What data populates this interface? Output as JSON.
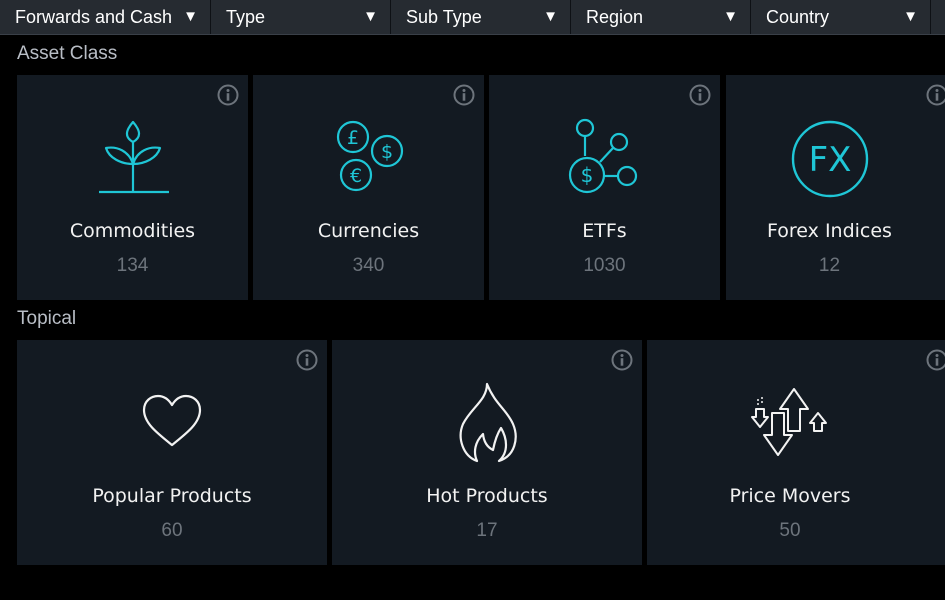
{
  "filters": [
    {
      "label": "Forwards and Cash"
    },
    {
      "label": "Type"
    },
    {
      "label": "Sub Type"
    },
    {
      "label": "Region"
    },
    {
      "label": "Country"
    }
  ],
  "sections": {
    "asset_class": {
      "title": "Asset Class",
      "tiles": [
        {
          "label": "Commodities",
          "count": "134",
          "icon": "plant-icon"
        },
        {
          "label": "Currencies",
          "count": "340",
          "icon": "currency-coins-icon"
        },
        {
          "label": "ETFs",
          "count": "1030",
          "icon": "etf-network-icon"
        },
        {
          "label": "Forex Indices",
          "count": "12",
          "icon": "fx-icon",
          "icon_text": "FX"
        }
      ]
    },
    "topical": {
      "title": "Topical",
      "tiles": [
        {
          "label": "Popular Products",
          "count": "60",
          "icon": "heart-icon"
        },
        {
          "label": "Hot Products",
          "count": "17",
          "icon": "flame-icon"
        },
        {
          "label": "Price Movers",
          "count": "50",
          "icon": "price-movers-icon"
        }
      ]
    }
  },
  "colors": {
    "accent": "#1fc6d6",
    "tile_bg": "#131a22",
    "filter_bg": "#262b31",
    "count_text": "#6d747c"
  }
}
